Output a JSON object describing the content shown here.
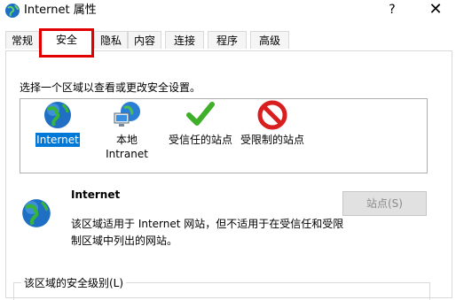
{
  "window": {
    "title": "Internet 属性",
    "help_label": "?",
    "close_label": "✕"
  },
  "tabs": [
    {
      "label": "常规",
      "active": false
    },
    {
      "label": "安全",
      "active": true
    },
    {
      "label": "隐私",
      "active": false
    },
    {
      "label": "内容",
      "active": false
    },
    {
      "label": "连接",
      "active": false
    },
    {
      "label": "程序",
      "active": false
    },
    {
      "label": "高级",
      "active": false
    }
  ],
  "security": {
    "instruction": "选择一个区域以查看或更改安全设置。",
    "zones": [
      {
        "label": "Internet",
        "icon": "globe-icon",
        "selected": true
      },
      {
        "label": "本地\nIntranet",
        "icon": "local-intranet-icon",
        "selected": false
      },
      {
        "label": "受信任的站点",
        "icon": "checkmark-icon",
        "selected": false
      },
      {
        "label": "受限制的站点",
        "icon": "restricted-icon",
        "selected": false
      }
    ],
    "detail": {
      "title": "Internet",
      "description": "该区域适用于 Internet 网站，但不适用于在受信任和受限制区域中列出的网站。",
      "sites_button": "站点(S)"
    },
    "level_group_label": "该区域的安全级别(L)"
  },
  "colors": {
    "highlight_border": "#e00000",
    "selection": "#0078d7",
    "check_green": "#3fae29",
    "restricted_red": "#d81e1e"
  }
}
